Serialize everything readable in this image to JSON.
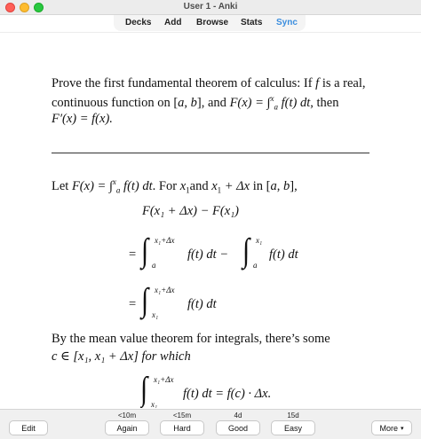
{
  "window": {
    "title": "User 1 - Anki"
  },
  "toolbar": {
    "decks": "Decks",
    "add": "Add",
    "browse": "Browse",
    "stats": "Stats",
    "sync": "Sync",
    "sync_color": "#3a8dde"
  },
  "card": {
    "question": {
      "line1_a": "Prove the first fundamental theorem of calculus: If ",
      "line1_f": "f",
      "line1_b": " is a real,",
      "line2_a": "continuous function on [",
      "line2_a_var": "a",
      "line2_comma": ", ",
      "line2_b_var": "b",
      "line2_b": "], and ",
      "line2_F": "F",
      "line2_x": "(x) = ∫",
      "line2_int_upper": "x",
      "line2_int_lower": "a",
      "line2_ft": " f(t) dt",
      "line2_then": ", then",
      "line3": "F′(x) = f(x)."
    },
    "answer": {
      "let_a": "Let ",
      "let_Fx": "F(x) = ∫",
      "let_upper": "x",
      "let_lower": "a",
      "let_ft": " f(t) dt",
      "let_b": ". For ",
      "let_x1": "x",
      "let_x1_sub": "1",
      "let_and": "and ",
      "let_x1d": "x",
      "let_x1d_sub": "1",
      "let_dx": " + Δx",
      "let_in": " in [",
      "let_ab_a": "a",
      "let_ab_comma": ", ",
      "let_ab_b": "b",
      "let_end": "],",
      "eq1": "F(x₁ + Δx) − F(x₁)",
      "eq2_prefix": "=",
      "eq2_upper1": "x₁+Δx",
      "eq2_lower1": "a",
      "eq2_mid": "f(t) dt −",
      "eq2_upper2": "x₁",
      "eq2_lower2": "a",
      "eq2_end": "f(t) dt",
      "eq3_prefix": "=",
      "eq3_upper": "x₁+Δx",
      "eq3_lower": "x₁",
      "eq3_end": "f(t) dt",
      "mvt_line1": "By the mean value theorem for integrals, there’s some",
      "mvt_line2": "c ∈ [x₁, x₁ + Δx] for which",
      "eq4_upper": "x₁+Δx",
      "eq4_lower": "x₁",
      "eq4_end": "f(t) dt = f(c) · Δx."
    }
  },
  "answer_bar": {
    "edit": "Edit",
    "again_interval": "<10m",
    "again": "Again",
    "hard_interval": "<15m",
    "hard": "Hard",
    "good_interval": "4d",
    "good": "Good",
    "easy_interval": "15d",
    "easy": "Easy",
    "more": "More",
    "more_caret": "▾"
  }
}
